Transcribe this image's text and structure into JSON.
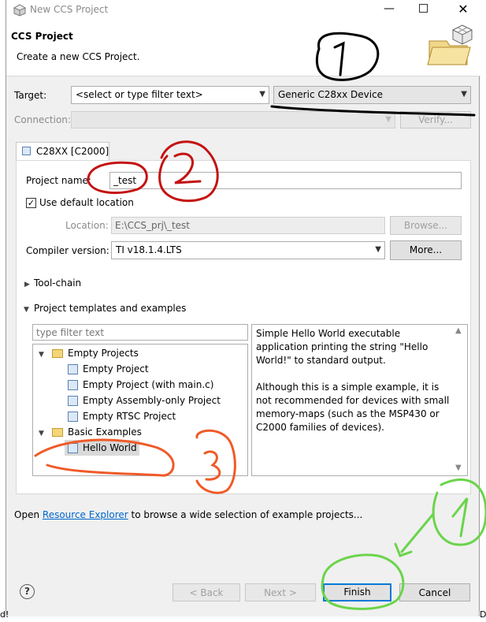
{
  "window": {
    "title": "New CCS Project",
    "icons": [
      "app-icon",
      "minimize-icon",
      "maximize-icon",
      "close-icon"
    ]
  },
  "header": {
    "title": "CCS Project",
    "subtitle": "Create a new CCS Project.",
    "banner_icon": "project-folder-banner-icon"
  },
  "target": {
    "label": "Target:",
    "filter_placeholder": "<select or type filter text>",
    "device_value": "Generic C28xx Device"
  },
  "connection": {
    "label": "Connection:",
    "value": "",
    "verify_label": "Verify..."
  },
  "device_tab": {
    "label": "C28XX [C2000]"
  },
  "project": {
    "name_label": "Project name:",
    "name_value": "_test",
    "use_default_label": "Use default location",
    "use_default_checked": true,
    "location_label": "Location:",
    "location_value": "E:\\CCS_prj\\_test",
    "browse_label": "Browse...",
    "compiler_label": "Compiler version:",
    "compiler_value": "TI v18.1.4.LTS",
    "more_label": "More..."
  },
  "sections": {
    "toolchain": "Tool-chain",
    "templates": "Project templates and examples"
  },
  "templates": {
    "filter_placeholder": "type filter text",
    "groups": [
      {
        "label": "Empty Projects",
        "expanded": true,
        "items": [
          "Empty Project",
          "Empty Project (with main.c)",
          "Empty Assembly-only Project",
          "Empty RTSC Project"
        ]
      },
      {
        "label": "Basic Examples",
        "expanded": true,
        "items": [
          "Hello World"
        ]
      }
    ],
    "selected": "Hello World",
    "description": "Simple Hello World executable application printing the string \"Hello World!\" to standard output.\n\nAlthough this is a simple example, it is not recommended for devices with small memory-maps (such as the MSP430 or C2000 families of devices)."
  },
  "footer": {
    "open_prefix": "Open",
    "resource_link": "Resource Explorer",
    "open_suffix": "to browse a wide selection of example projects...",
    "help_icon": "help-icon",
    "back_label": "< Back",
    "next_label": "Next >",
    "finish_label": "Finish",
    "cancel_label": "Cancel"
  },
  "annotations": {
    "colors": {
      "black": "#000000",
      "red": "#c41212",
      "orange": "#f05a28",
      "green": "#6bd44b"
    },
    "labels": [
      "1",
      "2",
      "3",
      "4"
    ]
  },
  "edge": {
    "left_text": "d!",
    "right_text": "D"
  }
}
